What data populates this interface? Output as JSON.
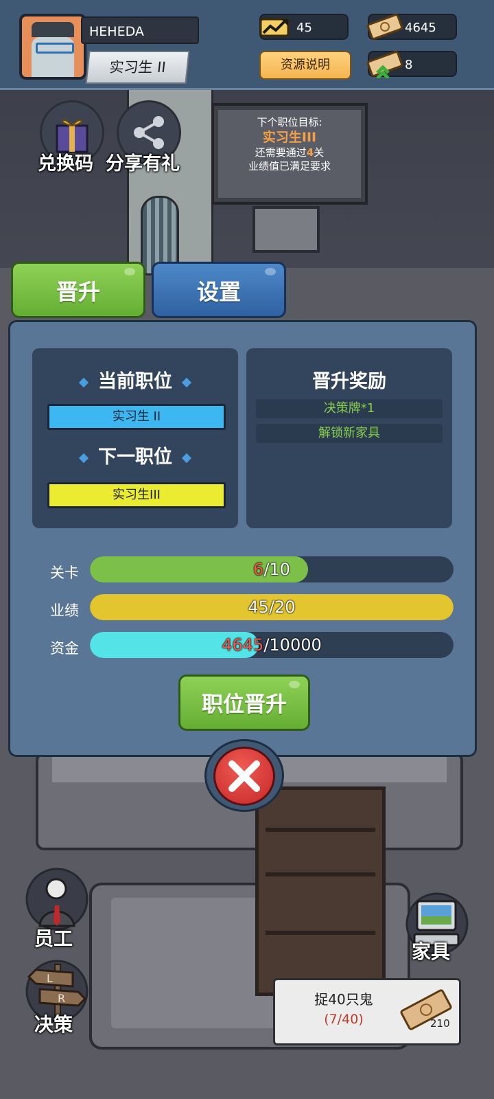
{
  "header": {
    "player_name": "HEHEDA",
    "rank": "实习生 II",
    "performance_value": "45",
    "money_value": "4645",
    "cards_value": "8",
    "resource_info_label": "资源说明"
  },
  "quick_buttons": {
    "redeem_label": "兑换码",
    "share_label": "分享有礼"
  },
  "goal_board": {
    "line1": "下个职位目标:",
    "target_rank": "实习生III",
    "line3_prefix": "还需要通过",
    "levels_remaining": "4",
    "line3_suffix": "关",
    "line4": "业绩值已满足要求"
  },
  "tabs": {
    "promote": "晋升",
    "settings": "设置"
  },
  "panel": {
    "current_title": "当前职位",
    "current_rank": "实习生 II",
    "next_title": "下一职位",
    "next_rank": "实习生III",
    "reward_title": "晋升奖励",
    "rewards": [
      "决策牌*1",
      "解锁新家具"
    ],
    "progress": [
      {
        "label": "关卡",
        "current": "6",
        "target": "/10",
        "fill": 0.6,
        "color": "#7cc04a",
        "current_red": true
      },
      {
        "label": "业绩",
        "current": "45",
        "target": "/20",
        "fill": 1.0,
        "color": "#e3c52f",
        "current_red": false
      },
      {
        "label": "资金",
        "current": "4645",
        "target": "/10000",
        "fill": 0.4645,
        "color": "#54e3e6",
        "current_red": true
      }
    ],
    "promote_button": "职位晋升"
  },
  "bottom": {
    "staff_label": "员工",
    "decision_label": "决策",
    "furniture_label": "家具",
    "task_title": "捉40只鬼",
    "task_progress": "(7/40)",
    "task_reward": "210"
  }
}
